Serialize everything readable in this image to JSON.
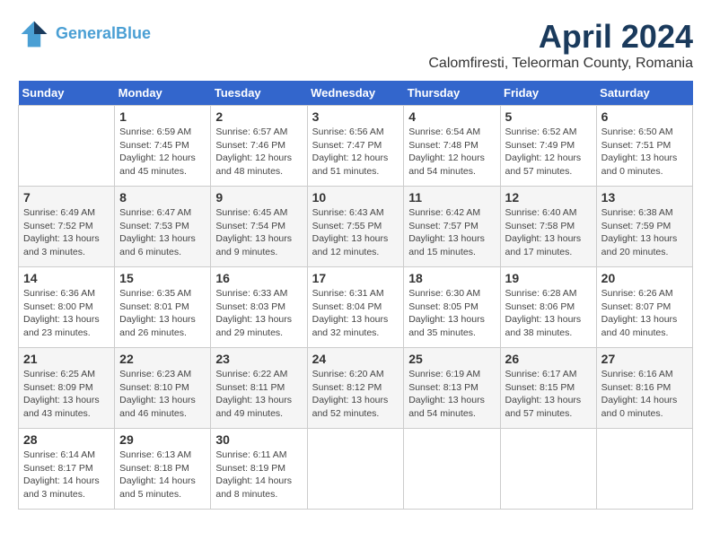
{
  "header": {
    "title": "April 2024",
    "subtitle": "Calomfiresti, Teleorman County, Romania",
    "logo_line1": "General",
    "logo_line2": "Blue"
  },
  "weekdays": [
    "Sunday",
    "Monday",
    "Tuesday",
    "Wednesday",
    "Thursday",
    "Friday",
    "Saturday"
  ],
  "weeks": [
    [
      {
        "day": "",
        "info": ""
      },
      {
        "day": "1",
        "info": "Sunrise: 6:59 AM\nSunset: 7:45 PM\nDaylight: 12 hours\nand 45 minutes."
      },
      {
        "day": "2",
        "info": "Sunrise: 6:57 AM\nSunset: 7:46 PM\nDaylight: 12 hours\nand 48 minutes."
      },
      {
        "day": "3",
        "info": "Sunrise: 6:56 AM\nSunset: 7:47 PM\nDaylight: 12 hours\nand 51 minutes."
      },
      {
        "day": "4",
        "info": "Sunrise: 6:54 AM\nSunset: 7:48 PM\nDaylight: 12 hours\nand 54 minutes."
      },
      {
        "day": "5",
        "info": "Sunrise: 6:52 AM\nSunset: 7:49 PM\nDaylight: 12 hours\nand 57 minutes."
      },
      {
        "day": "6",
        "info": "Sunrise: 6:50 AM\nSunset: 7:51 PM\nDaylight: 13 hours\nand 0 minutes."
      }
    ],
    [
      {
        "day": "7",
        "info": "Sunrise: 6:49 AM\nSunset: 7:52 PM\nDaylight: 13 hours\nand 3 minutes."
      },
      {
        "day": "8",
        "info": "Sunrise: 6:47 AM\nSunset: 7:53 PM\nDaylight: 13 hours\nand 6 minutes."
      },
      {
        "day": "9",
        "info": "Sunrise: 6:45 AM\nSunset: 7:54 PM\nDaylight: 13 hours\nand 9 minutes."
      },
      {
        "day": "10",
        "info": "Sunrise: 6:43 AM\nSunset: 7:55 PM\nDaylight: 13 hours\nand 12 minutes."
      },
      {
        "day": "11",
        "info": "Sunrise: 6:42 AM\nSunset: 7:57 PM\nDaylight: 13 hours\nand 15 minutes."
      },
      {
        "day": "12",
        "info": "Sunrise: 6:40 AM\nSunset: 7:58 PM\nDaylight: 13 hours\nand 17 minutes."
      },
      {
        "day": "13",
        "info": "Sunrise: 6:38 AM\nSunset: 7:59 PM\nDaylight: 13 hours\nand 20 minutes."
      }
    ],
    [
      {
        "day": "14",
        "info": "Sunrise: 6:36 AM\nSunset: 8:00 PM\nDaylight: 13 hours\nand 23 minutes."
      },
      {
        "day": "15",
        "info": "Sunrise: 6:35 AM\nSunset: 8:01 PM\nDaylight: 13 hours\nand 26 minutes."
      },
      {
        "day": "16",
        "info": "Sunrise: 6:33 AM\nSunset: 8:03 PM\nDaylight: 13 hours\nand 29 minutes."
      },
      {
        "day": "17",
        "info": "Sunrise: 6:31 AM\nSunset: 8:04 PM\nDaylight: 13 hours\nand 32 minutes."
      },
      {
        "day": "18",
        "info": "Sunrise: 6:30 AM\nSunset: 8:05 PM\nDaylight: 13 hours\nand 35 minutes."
      },
      {
        "day": "19",
        "info": "Sunrise: 6:28 AM\nSunset: 8:06 PM\nDaylight: 13 hours\nand 38 minutes."
      },
      {
        "day": "20",
        "info": "Sunrise: 6:26 AM\nSunset: 8:07 PM\nDaylight: 13 hours\nand 40 minutes."
      }
    ],
    [
      {
        "day": "21",
        "info": "Sunrise: 6:25 AM\nSunset: 8:09 PM\nDaylight: 13 hours\nand 43 minutes."
      },
      {
        "day": "22",
        "info": "Sunrise: 6:23 AM\nSunset: 8:10 PM\nDaylight: 13 hours\nand 46 minutes."
      },
      {
        "day": "23",
        "info": "Sunrise: 6:22 AM\nSunset: 8:11 PM\nDaylight: 13 hours\nand 49 minutes."
      },
      {
        "day": "24",
        "info": "Sunrise: 6:20 AM\nSunset: 8:12 PM\nDaylight: 13 hours\nand 52 minutes."
      },
      {
        "day": "25",
        "info": "Sunrise: 6:19 AM\nSunset: 8:13 PM\nDaylight: 13 hours\nand 54 minutes."
      },
      {
        "day": "26",
        "info": "Sunrise: 6:17 AM\nSunset: 8:15 PM\nDaylight: 13 hours\nand 57 minutes."
      },
      {
        "day": "27",
        "info": "Sunrise: 6:16 AM\nSunset: 8:16 PM\nDaylight: 14 hours\nand 0 minutes."
      }
    ],
    [
      {
        "day": "28",
        "info": "Sunrise: 6:14 AM\nSunset: 8:17 PM\nDaylight: 14 hours\nand 3 minutes."
      },
      {
        "day": "29",
        "info": "Sunrise: 6:13 AM\nSunset: 8:18 PM\nDaylight: 14 hours\nand 5 minutes."
      },
      {
        "day": "30",
        "info": "Sunrise: 6:11 AM\nSunset: 8:19 PM\nDaylight: 14 hours\nand 8 minutes."
      },
      {
        "day": "",
        "info": ""
      },
      {
        "day": "",
        "info": ""
      },
      {
        "day": "",
        "info": ""
      },
      {
        "day": "",
        "info": ""
      }
    ]
  ]
}
